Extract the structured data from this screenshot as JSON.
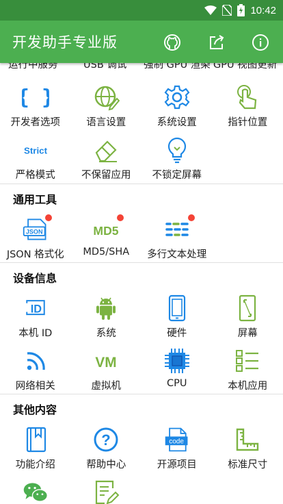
{
  "status_bar": {
    "time": "10:42"
  },
  "app": {
    "title": "开发助手专业版",
    "accent": "#4caf50",
    "status_color": "#388e3c",
    "actions": [
      "github-icon",
      "share-icon",
      "info-icon"
    ]
  },
  "top_partial": {
    "items": [
      "运行中服务",
      "USB 调试",
      "强制 GPU 渲染",
      "GPU 视图更新"
    ]
  },
  "dev_options": {
    "items": [
      {
        "label": "开发者选项",
        "icon": "braces-icon"
      },
      {
        "label": "语言设置",
        "icon": "globe-icon"
      },
      {
        "label": "系统设置",
        "icon": "gear-icon"
      },
      {
        "label": "指针位置",
        "icon": "pointer-icon"
      },
      {
        "label": "严格模式",
        "icon": "strict-icon",
        "glyph": "Strict"
      },
      {
        "label": "不保留应用",
        "icon": "eraser-icon"
      },
      {
        "label": "不锁定屏幕",
        "icon": "lightbulb-icon"
      }
    ]
  },
  "tools": {
    "title": "通用工具",
    "items": [
      {
        "label": "JSON 格式化",
        "icon": "json-icon",
        "glyph": "JSON"
      },
      {
        "label": "MD5/SHA",
        "icon": "md5-icon",
        "glyph": "MD5"
      },
      {
        "label": "多行文本处理",
        "icon": "multiline-text-icon"
      }
    ]
  },
  "device": {
    "title": "设备信息",
    "items": [
      {
        "label": "本机 ID",
        "icon": "id-icon",
        "glyph": "ID"
      },
      {
        "label": "系统",
        "icon": "android-icon"
      },
      {
        "label": "硬件",
        "icon": "phone-icon"
      },
      {
        "label": "屏幕",
        "icon": "screen-icon"
      },
      {
        "label": "网络相关",
        "icon": "wifi-icon"
      },
      {
        "label": "虚拟机",
        "icon": "vm-icon",
        "glyph": "VM"
      },
      {
        "label": "CPU",
        "icon": "cpu-icon"
      },
      {
        "label": "本机应用",
        "icon": "apps-list-icon"
      }
    ]
  },
  "other": {
    "title": "其他内容",
    "items": [
      {
        "label": "功能介绍",
        "icon": "book-icon"
      },
      {
        "label": "帮助中心",
        "icon": "help-icon",
        "glyph": "?"
      },
      {
        "label": "开源项目",
        "icon": "code-file-icon",
        "glyph": "code"
      },
      {
        "label": "标准尺寸",
        "icon": "ruler-icon"
      },
      {
        "label": "",
        "icon": "wechat-icon"
      },
      {
        "label": "",
        "icon": "feedback-icon"
      }
    ]
  }
}
